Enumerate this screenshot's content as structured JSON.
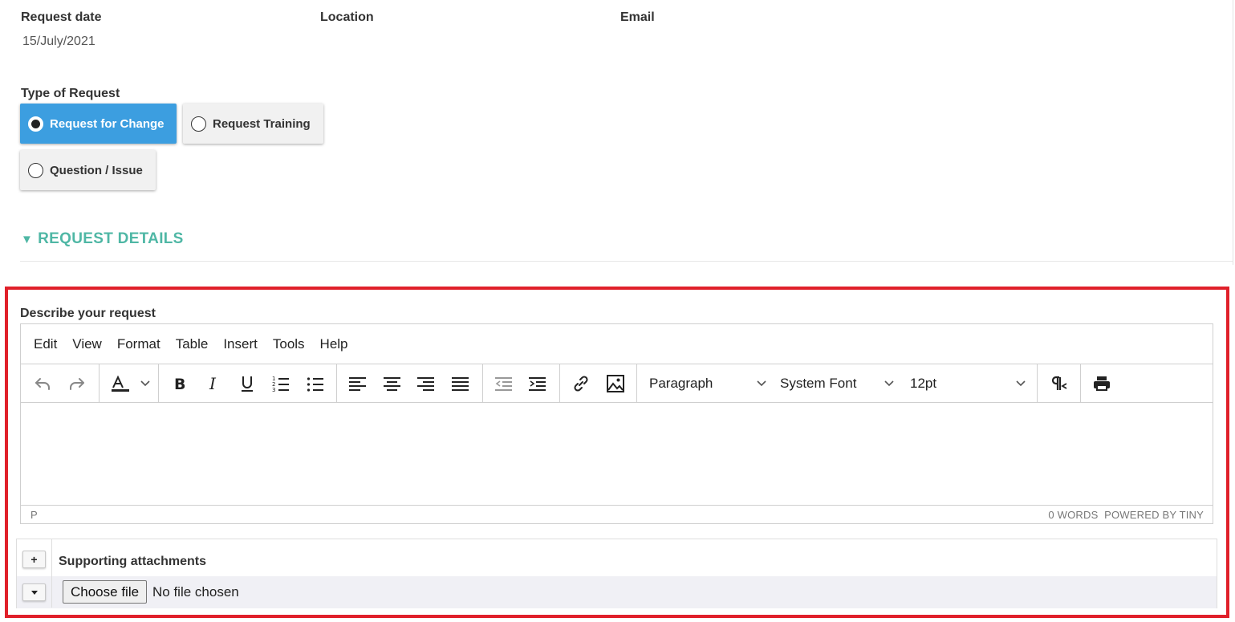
{
  "header": {
    "request_date_label": "Request date",
    "request_date_value": "15/July/2021",
    "location_label": "Location",
    "email_label": "Email"
  },
  "request_type": {
    "label": "Type of Request",
    "options": [
      {
        "label": "Request for Change",
        "selected": true
      },
      {
        "label": "Request Training",
        "selected": false
      },
      {
        "label": "Question / Issue",
        "selected": false
      }
    ]
  },
  "section": {
    "arrow": "▼",
    "title": "REQUEST DETAILS"
  },
  "editor": {
    "label": "Describe your request",
    "menu": [
      "Edit",
      "View",
      "Format",
      "Table",
      "Insert",
      "Tools",
      "Help"
    ],
    "toolbar_icons": [
      "undo-icon",
      "redo-icon",
      "text-color-icon",
      "bold-icon",
      "italic-icon",
      "underline-icon",
      "numbered-list-icon",
      "bullet-list-icon",
      "align-left-icon",
      "align-center-icon",
      "align-right-icon",
      "justify-icon",
      "outdent-icon",
      "indent-icon",
      "link-icon",
      "image-icon",
      "rtl-paragraph-icon",
      "print-icon"
    ],
    "block_format": "Paragraph",
    "font_family": "System Font",
    "font_size": "12pt",
    "status_path": "P",
    "word_count": "0 WORDS",
    "powered_by": "POWERED BY TINY"
  },
  "attachments": {
    "add_symbol": "+",
    "title": "Supporting attachments",
    "choose_file_label": "Choose file",
    "file_status": "No file chosen"
  },
  "colors": {
    "selected_radio_bg": "#3c9ee0",
    "section_title": "#4fb7a5",
    "highlight_border": "#e0202a"
  }
}
